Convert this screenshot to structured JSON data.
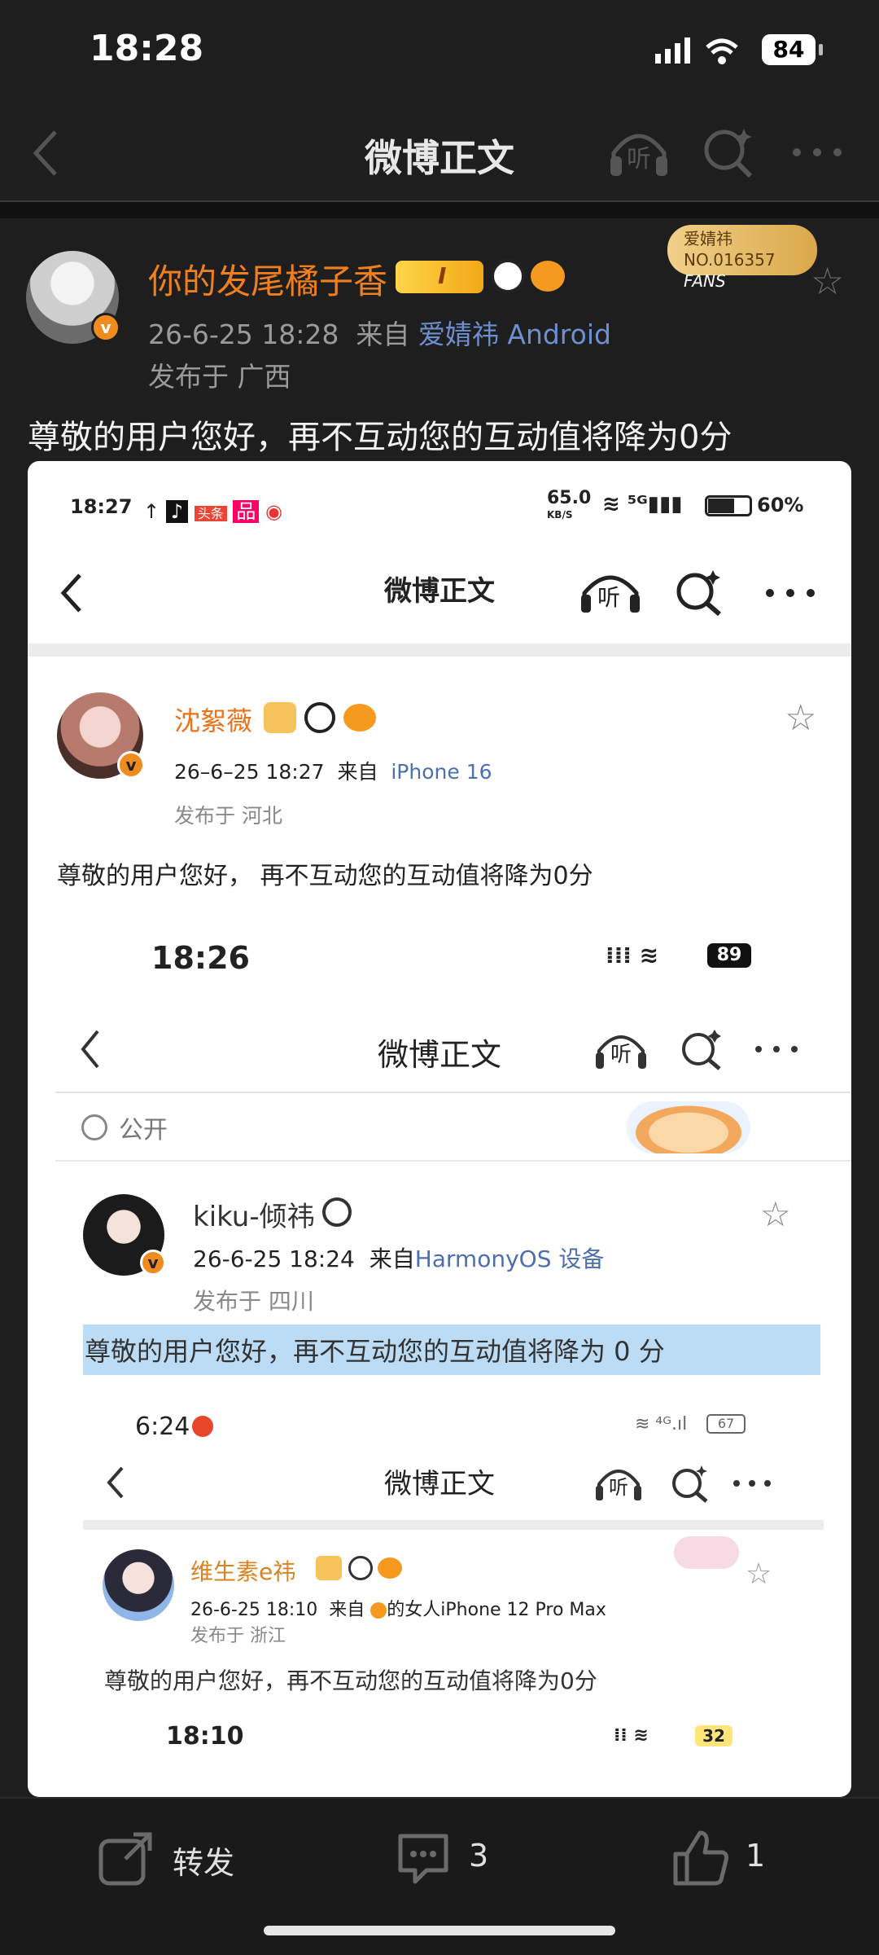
{
  "status_bar": {
    "time": "18:28",
    "battery": "84"
  },
  "nav": {
    "title": "微博正文",
    "listen_label": "听"
  },
  "post": {
    "username": "你的发尾橘子香",
    "level_badge": "I",
    "meta_date": "26-6-25 18:28",
    "meta_from": "来自",
    "source": "爱婧祎 Android",
    "location": "发布于 广西",
    "fans_badge_name": "爱婧祎",
    "fans_badge_no": "NO.016357",
    "fans_badge_tag": "FANS",
    "text": "尊敬的用户您好，再不互动您的互动值将降为0分"
  },
  "screenshot1": {
    "time": "18:27",
    "net_speed": "65.0",
    "net_unit": "KB/S",
    "battery": "60%",
    "nav_title": "微博正文",
    "listen_label": "听",
    "username": "沈絮薇",
    "meta_date": "26–6–25 18:27",
    "meta_from": "来自",
    "source": "iPhone 16",
    "location": "发布于 河北",
    "text": "尊敬的用户您好， 再不互动您的互动值将降为0分"
  },
  "screenshot2": {
    "time": "18:26",
    "battery": "89",
    "nav_title": "微博正文",
    "listen_label": "听",
    "visibility": "公开",
    "username": "kiku-倾祎",
    "meta_date": "26-6-25 18:24",
    "meta_from": "来自",
    "source": "HarmonyOS 设备",
    "location": "发布于 四川",
    "text": "尊敬的用户您好，再不互动您的互动值将降为 0 分"
  },
  "screenshot3": {
    "time": "6:24",
    "battery": "67",
    "nav_title": "微博正文",
    "listen_label": "听",
    "username": "维生素e祎",
    "meta_date": "26-6-25 18:10",
    "meta_from": "来自",
    "source": "的女人iPhone 12 Pro Max",
    "location": "发布于 浙江",
    "text": "尊敬的用户您好，再不互动您的互动值将降为0分"
  },
  "screenshot4": {
    "time": "18:10",
    "battery": "32"
  },
  "bottom_bar": {
    "repost_label": "转发",
    "comment_count": "3",
    "like_count": "1"
  },
  "colors": {
    "username": "#f0801e",
    "source_link": "#6d8fd0",
    "highlight": "#bcdcf5"
  }
}
